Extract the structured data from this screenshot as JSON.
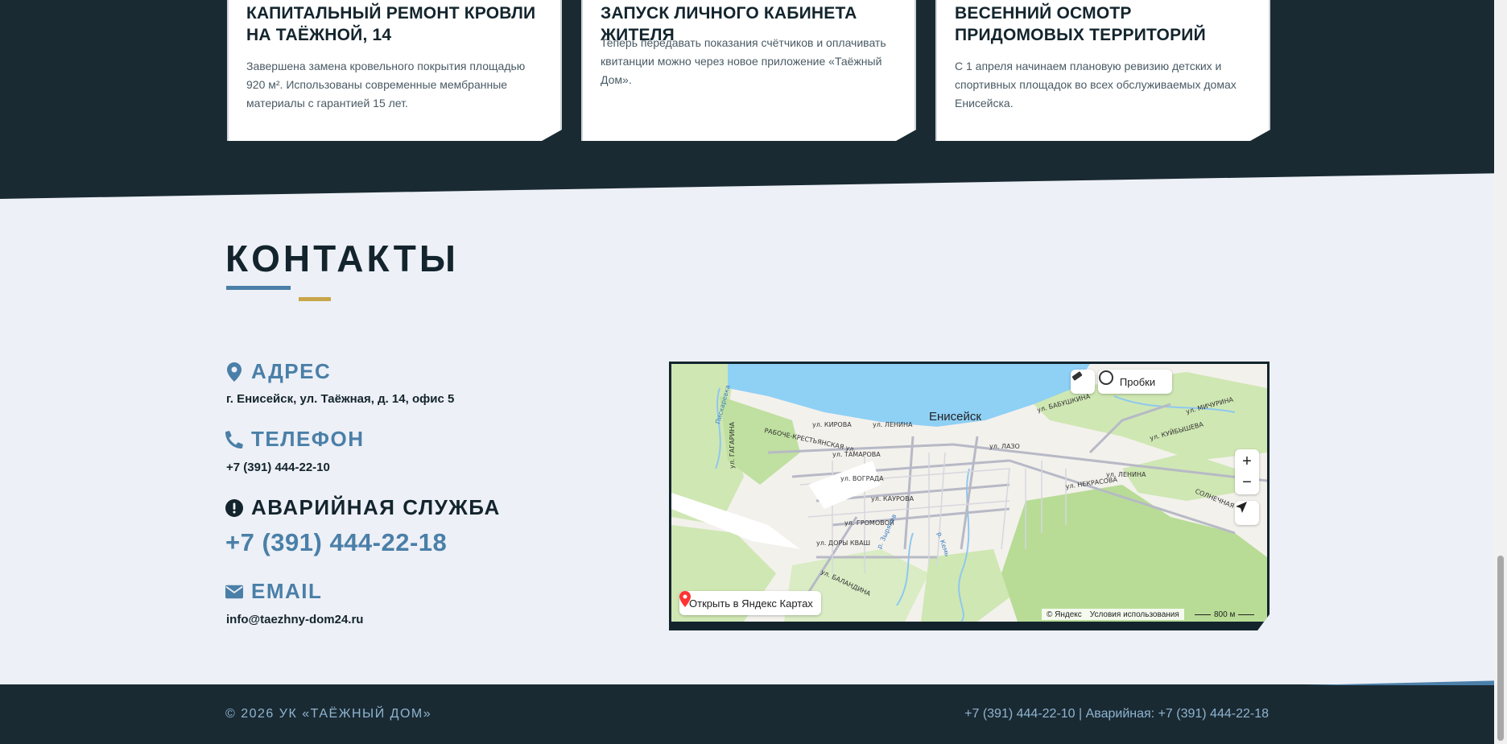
{
  "news": {
    "cards": [
      {
        "title": "КАПИТАЛЬНЫЙ РЕМОНТ КРОВЛИ НА ТАЁЖНОЙ, 14",
        "text": "Завершена замена кровельного покрытия площадью 920 м². Использованы современные мембранные материалы с гарантией 15 лет."
      },
      {
        "title": "ЗАПУСК ЛИЧНОГО КАБИНЕТА ЖИТЕЛЯ",
        "text": "Теперь передавать показания счётчиков и оплачивать квитанции можно через новое приложение «Таёжный Дом»."
      },
      {
        "title": "ВЕСЕННИЙ ОСМОТР ПРИДОМОВЫХ ТЕРРИТОРИЙ",
        "text": "С 1 апреля начинаем плановую ревизию детских и спортивных площадок во всех обслуживаемых домах Енисейска."
      }
    ]
  },
  "contacts": {
    "title": "КОНТАКТЫ",
    "address_label": "АДРЕС",
    "address_value": "г. Енисейск, ул. Таёжная, д. 14, офис 5",
    "phone_label": "ТЕЛЕФОН",
    "phone_value": "+7 (391) 444-22-10",
    "emergency_label": "АВАРИЙНАЯ СЛУЖБА",
    "emergency_value": "+7 (391) 444-22-18",
    "email_label": "EMAIL",
    "email_value": "info@taezhny-dom24.ru"
  },
  "map": {
    "city": "Енисейск",
    "traffic_label": "Пробки",
    "zoom_in": "+",
    "zoom_out": "−",
    "open_label": "Открыть в Яндекс Картах",
    "copyright": "© Яндекс",
    "terms": "Условия использования",
    "scale": "800 м",
    "streets": [
      "ул. КИРОВА",
      "ул. ЛЕНИНА",
      "РАБОЧЕ-КРЕСТЬЯНСКАЯ ул.",
      "ул. ТАМАРОВА",
      "ул. ВОГРАДА",
      "ул. КАУРОВА",
      "ул. ГРОМОВОЙ",
      "ул. ДОРЫ КВАШ",
      "ул. БАЛАНДИНА",
      "ул. ЛАЗО",
      "ул. БАБУШКИНА",
      "ул. МИЧУРИНА",
      "ул. КУЙБЫШЕВА",
      "ул. ЛЕНИНА",
      "ул. НЕКРАСОВА",
      "СОЛНЕЧНАЯ ул.",
      "ул. ГАГАРИНА",
      "Пискаревка",
      "р. Кемь",
      "р. Зырянов"
    ]
  },
  "footer": {
    "copyright": "© 2026 УК «ТАЁЖНЫЙ ДОМ»",
    "contacts": "+7 (391) 444-22-10 | Аварийная: +7 (391) 444-22-18"
  },
  "colors": {
    "dark": "#1a2a33",
    "accent": "#4a7fa8",
    "gold": "#c8a64a",
    "light": "#edf0f6"
  }
}
